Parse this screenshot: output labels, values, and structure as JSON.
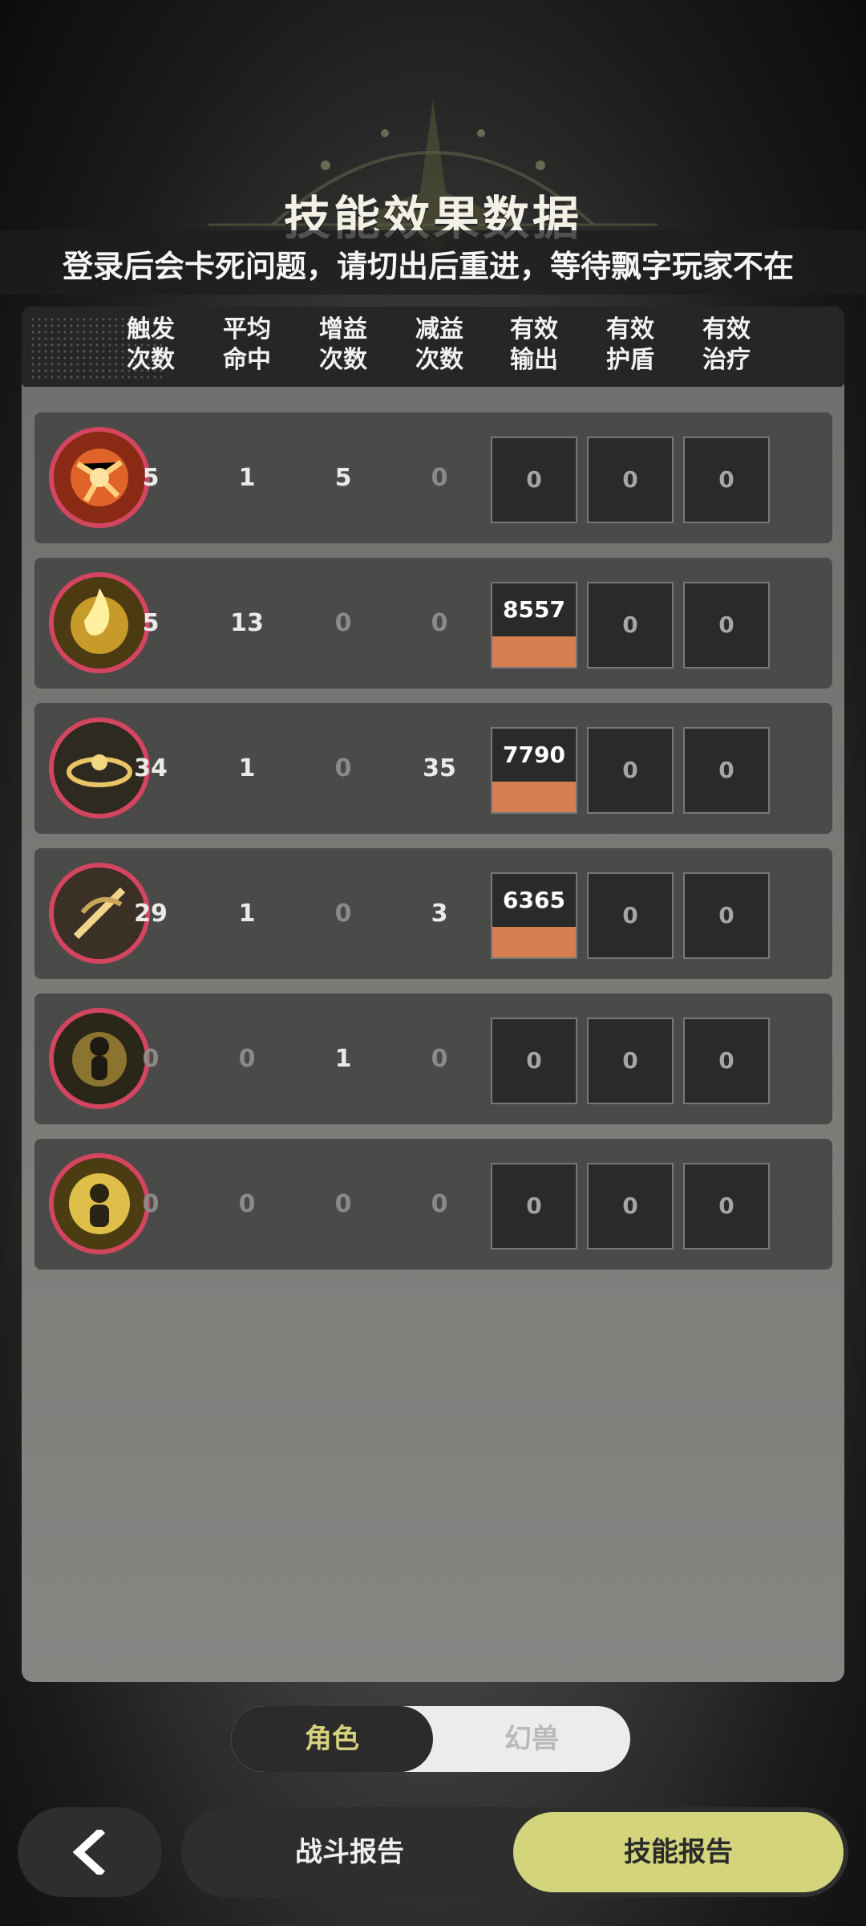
{
  "header": {
    "title": "技能效果数据",
    "notice": "登录后会卡死问题，请切出后重进，等待飘字玩家不在",
    "faded_subtitle": "战斗报告"
  },
  "columns": [
    [
      "触发",
      "次数"
    ],
    [
      "平均",
      "命中"
    ],
    [
      "增益",
      "次数"
    ],
    [
      "减益",
      "次数"
    ],
    [
      "有效",
      "输出"
    ],
    [
      "有效",
      "护盾"
    ],
    [
      "有效",
      "治疗"
    ]
  ],
  "rows": [
    {
      "icon": "fire-burst-skill-icon",
      "trigger": "5",
      "avg_hit": "1",
      "buff": "5",
      "debuff": "0",
      "output": "0",
      "output_fill": 0,
      "shield": "0",
      "heal": "0"
    },
    {
      "icon": "golden-flame-skill-icon",
      "trigger": "5",
      "avg_hit": "13",
      "buff": "0",
      "debuff": "0",
      "output": "8557万",
      "output_fill": 1,
      "shield": "0",
      "heal": "0"
    },
    {
      "icon": "golden-ring-skill-icon",
      "trigger": "34",
      "avg_hit": "1",
      "buff": "0",
      "debuff": "35",
      "output": "7790万",
      "output_fill": 1,
      "shield": "0",
      "heal": "0"
    },
    {
      "icon": "sword-slash-skill-icon",
      "trigger": "29",
      "avg_hit": "1",
      "buff": "0",
      "debuff": "3",
      "output": "6365万",
      "output_fill": 1,
      "shield": "0",
      "heal": "0"
    },
    {
      "icon": "golden-figure-skill-icon",
      "trigger": "0",
      "avg_hit": "0",
      "buff": "1",
      "debuff": "0",
      "output": "0",
      "output_fill": 0,
      "shield": "0",
      "heal": "0"
    },
    {
      "icon": "golden-aura-skill-icon",
      "trigger": "0",
      "avg_hit": "0",
      "buff": "0",
      "debuff": "0",
      "output": "0",
      "output_fill": 0,
      "shield": "0",
      "heal": "0"
    }
  ],
  "toggle": {
    "active": "角色",
    "inactive": "幻兽"
  },
  "bottom": {
    "left": "战斗报告",
    "right": "技能报告"
  },
  "colors": {
    "accent_yellow": "#d3d47b",
    "bar_orange": "#d57f50",
    "ring_red": "#d4455f"
  }
}
